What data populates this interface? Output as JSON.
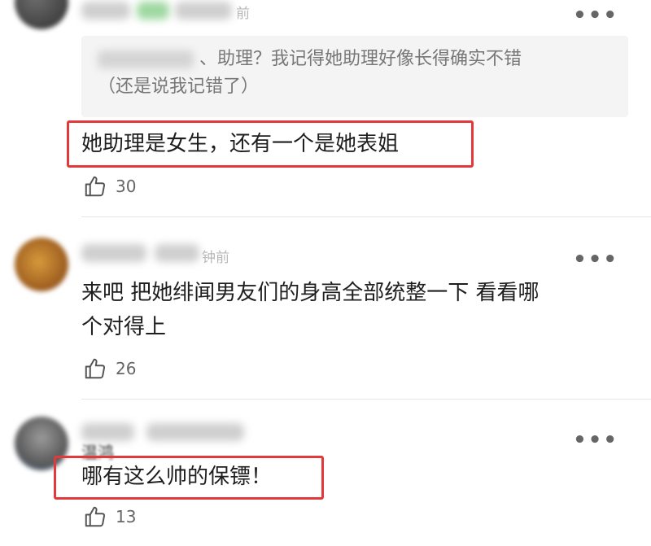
{
  "comments": [
    {
      "time": "前",
      "quote": {
        "prefix": "、助理？我记得她助理好像长得确实不错",
        "line2": "（还是说我记错了）"
      },
      "text": "她助理是女生，还有一个是她表姐",
      "likes": "30",
      "highlighted": true
    },
    {
      "time": "钟前",
      "text_line1": "来吧 把她绯闻男友们的身高全部统整一下 看看哪",
      "text_line2": "个对得上",
      "likes": "26",
      "highlighted": false
    },
    {
      "username_partial": "温鸿",
      "text": "哪有这么帅的保镖！",
      "likes": "13",
      "highlighted": true
    }
  ],
  "icons": {
    "more": "more-dots-icon",
    "like": "thumbs-up-icon"
  },
  "colors": {
    "highlight": "#e23a3a",
    "quote_bg": "#f4f4f4",
    "meta": "#b8b8b8"
  },
  "more_label": "•••"
}
